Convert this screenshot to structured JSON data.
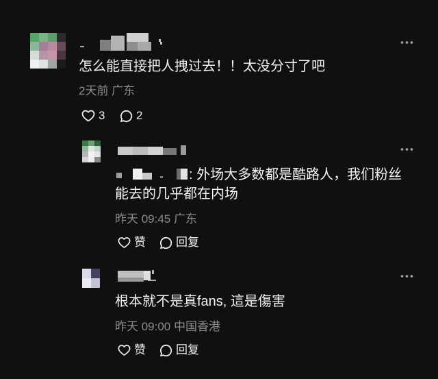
{
  "comment": {
    "text": "怎么能直接把人拽过去！！太没分寸了吧",
    "meta": "2天前 广东",
    "likes": "3",
    "reply_count": "2"
  },
  "replies": [
    {
      "text": ": 外场大多数都是酷路人，我们粉丝能去的几乎都在内场",
      "meta": "昨天 09:45 广东",
      "like_label": "赞",
      "reply_label": "回复"
    },
    {
      "text": "根本就不是真fans, 這是傷害",
      "meta": "昨天 09:00 中国香港",
      "like_label": "赞",
      "reply_label": "回复"
    }
  ],
  "icons": {
    "more": "more-icon",
    "like": "heart-icon",
    "reply": "comment-bubble-icon"
  },
  "colors": {
    "background": "#101010",
    "text": "#f2f2f2",
    "muted": "#8c8c8c"
  }
}
